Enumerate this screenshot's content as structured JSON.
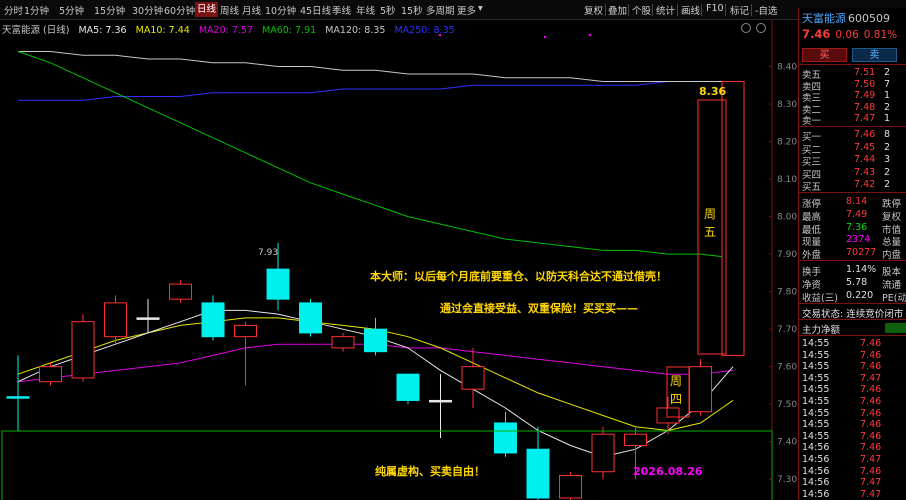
{
  "toolbar": {
    "periods": [
      "分时",
      "1分钟",
      "5分钟",
      "15分钟",
      "30分钟",
      "60分钟",
      "日线",
      "周线",
      "月线",
      "10分钟",
      "45日线",
      "季线",
      "年线",
      "5秒",
      "15秒",
      "多周期",
      "更多"
    ],
    "active_period": "日线",
    "tools": [
      "复权",
      "叠加",
      "个股",
      "统计",
      "画线",
      "F10",
      "标记",
      "-自选"
    ]
  },
  "chart": {
    "stock_label": "天富能源 (日线)",
    "ma5": "MA5: 7.36",
    "ma10": "MA10: 7.44",
    "ma20": "MA20: 7.57",
    "ma60": "MA60: 7.91",
    "ma120": "MA120: 8.35",
    "ma250": "MA250: 8.35",
    "y_ticks": [
      "8.40",
      "8.30",
      "8.20",
      "8.10",
      "8.00",
      "7.90",
      "7.80",
      "7.70",
      "7.60",
      "7.50",
      "7.40",
      "7.30"
    ],
    "high_marker": "7.93",
    "peak_label": "8.36",
    "annotation_1": "本大师：以后每个月底前要重仓、以防天科合达不通过借壳！",
    "annotation_2": "通过会直接受益、双重保险！买买买——",
    "annotation_3": "纯属虚构、买卖自由！",
    "annotation_date": "2026.08.26",
    "box_label_1": "周五",
    "box_label_2": "周四",
    "colors": {
      "up": "#ff3030",
      "down": "#00f0f0",
      "ma5": "#e8e8e8",
      "ma10": "#e8e800",
      "ma20": "#e000e0",
      "ma60": "#00c000",
      "ma120": "#c8c8c8",
      "ma250": "#3030ff",
      "annotation": "#ffd700"
    }
  },
  "chart_data": {
    "type": "candlestick",
    "ylim": [
      7.25,
      8.46
    ],
    "candles": [
      {
        "o": 7.52,
        "c": 7.52,
        "h": 7.63,
        "l": 7.43,
        "dir": "down"
      },
      {
        "o": 7.56,
        "c": 7.6,
        "h": 7.61,
        "l": 7.55,
        "dir": "up"
      },
      {
        "o": 7.57,
        "c": 7.72,
        "h": 7.74,
        "l": 7.56,
        "dir": "up"
      },
      {
        "o": 7.68,
        "c": 7.77,
        "h": 7.79,
        "l": 7.66,
        "dir": "up"
      },
      {
        "o": 7.73,
        "c": 7.73,
        "h": 7.78,
        "l": 7.69,
        "dir": "flat"
      },
      {
        "o": 7.78,
        "c": 7.82,
        "h": 7.83,
        "l": 7.77,
        "dir": "up"
      },
      {
        "o": 7.77,
        "c": 7.68,
        "h": 7.79,
        "l": 7.67,
        "dir": "down"
      },
      {
        "o": 7.68,
        "c": 7.71,
        "h": 7.72,
        "l": 7.55,
        "dir": "up"
      },
      {
        "o": 7.86,
        "c": 7.78,
        "h": 7.93,
        "l": 7.75,
        "dir": "down"
      },
      {
        "o": 7.77,
        "c": 7.69,
        "h": 7.78,
        "l": 7.68,
        "dir": "down"
      },
      {
        "o": 7.65,
        "c": 7.68,
        "h": 7.69,
        "l": 7.64,
        "dir": "up"
      },
      {
        "o": 7.7,
        "c": 7.64,
        "h": 7.73,
        "l": 7.63,
        "dir": "down"
      },
      {
        "o": 7.58,
        "c": 7.51,
        "h": 7.58,
        "l": 7.5,
        "dir": "down"
      },
      {
        "o": 7.51,
        "c": 7.51,
        "h": 7.58,
        "l": 7.41,
        "dir": "flat"
      },
      {
        "o": 7.54,
        "c": 7.6,
        "h": 7.65,
        "l": 7.49,
        "dir": "up"
      },
      {
        "o": 7.45,
        "c": 7.37,
        "h": 7.48,
        "l": 7.36,
        "dir": "down"
      },
      {
        "o": 7.38,
        "c": 7.25,
        "h": 7.44,
        "l": 7.23,
        "dir": "down"
      },
      {
        "o": 7.25,
        "c": 7.31,
        "h": 7.32,
        "l": 7.2,
        "dir": "up"
      },
      {
        "o": 7.32,
        "c": 7.42,
        "h": 7.44,
        "l": 7.3,
        "dir": "up"
      },
      {
        "o": 7.39,
        "c": 7.42,
        "h": 7.44,
        "l": 7.3,
        "dir": "up"
      },
      {
        "o": 7.45,
        "c": 7.49,
        "h": 7.52,
        "l": 7.42,
        "dir": "up"
      },
      {
        "o": 7.48,
        "c": 7.6,
        "h": 7.62,
        "l": 7.47,
        "dir": "up"
      },
      {
        "o": 7.63,
        "c": 8.36,
        "h": 8.36,
        "l": 7.63,
        "dir": "up"
      }
    ],
    "ma5": [
      7.56,
      7.6,
      7.63,
      7.66,
      7.69,
      7.72,
      7.75,
      7.75,
      7.74,
      7.72,
      7.7,
      7.68,
      7.65,
      7.59,
      7.54,
      7.49,
      7.43,
      7.39,
      7.36,
      7.38,
      7.43,
      7.5,
      7.6
    ],
    "ma10": [
      7.58,
      7.61,
      7.64,
      7.67,
      7.69,
      7.71,
      7.72,
      7.73,
      7.73,
      7.72,
      7.71,
      7.7,
      7.68,
      7.65,
      7.61,
      7.57,
      7.53,
      7.5,
      7.47,
      7.44,
      7.43,
      7.45,
      7.51
    ],
    "ma20": [
      7.56,
      7.57,
      7.58,
      7.59,
      7.6,
      7.61,
      7.63,
      7.65,
      7.66,
      7.66,
      7.66,
      7.66,
      7.65,
      7.65,
      7.64,
      7.63,
      7.62,
      7.61,
      7.6,
      7.59,
      7.58,
      7.58,
      7.59
    ],
    "ma60": [
      8.44,
      8.41,
      8.37,
      8.33,
      8.29,
      8.25,
      8.21,
      8.17,
      8.13,
      8.09,
      8.06,
      8.03,
      8.0,
      7.98,
      7.96,
      7.94,
      7.93,
      7.92,
      7.91,
      7.91,
      7.9,
      7.9,
      7.89
    ],
    "ma120": [
      8.44,
      8.44,
      8.43,
      8.43,
      8.42,
      8.42,
      8.41,
      8.41,
      8.4,
      8.4,
      8.39,
      8.39,
      8.38,
      8.38,
      8.38,
      8.37,
      8.37,
      8.37,
      8.36,
      8.36,
      8.36,
      8.36,
      8.36
    ],
    "ma250": [
      8.31,
      8.31,
      8.31,
      8.32,
      8.32,
      8.32,
      8.33,
      8.33,
      8.33,
      8.33,
      8.34,
      8.34,
      8.34,
      8.34,
      8.35,
      8.35,
      8.35,
      8.35,
      8.35,
      8.35,
      8.36,
      8.36,
      8.36
    ]
  },
  "panel": {
    "name": "天富能源",
    "code": "600509",
    "price": "7.46",
    "change": "0.06",
    "pct": "0.81%",
    "buy_btn": "买",
    "sell_btn": "卖",
    "asks": [
      {
        "label": "卖五",
        "price": "7.51",
        "vol": "2"
      },
      {
        "label": "卖四",
        "price": "7.50",
        "vol": "7"
      },
      {
        "label": "卖三",
        "price": "7.49",
        "vol": "1"
      },
      {
        "label": "卖二",
        "price": "7.48",
        "vol": "2"
      },
      {
        "label": "卖一",
        "price": "7.47",
        "vol": "1"
      }
    ],
    "bids": [
      {
        "label": "买一",
        "price": "7.46",
        "vol": "8"
      },
      {
        "label": "买二",
        "price": "7.45",
        "vol": "2"
      },
      {
        "label": "买三",
        "price": "7.44",
        "vol": "3"
      },
      {
        "label": "买四",
        "price": "7.43",
        "vol": "2"
      },
      {
        "label": "买五",
        "price": "7.42",
        "vol": "2"
      }
    ],
    "stats": [
      {
        "k": "涨停",
        "v": "8.14",
        "k2": "跌停"
      },
      {
        "k": "最高",
        "v": "7.49",
        "k2": "复权"
      },
      {
        "k": "最低",
        "v": "7.36",
        "k2": "市值"
      },
      {
        "k": "现量",
        "v": "2374",
        "k2": "总量"
      },
      {
        "k": "外盘",
        "v": "70277",
        "k2": "内盘"
      }
    ],
    "stats2": [
      {
        "k": "换手",
        "v": "1.14%",
        "k2": "股本"
      },
      {
        "k": "净资",
        "v": "5.78",
        "k2": "流通"
      },
      {
        "k": "收益(三)",
        "v": "0.220",
        "k2": "PE(动)"
      }
    ],
    "trade_status": "交易状态: 连续竞价闭市",
    "net_inflow": "主力净额",
    "ticks": [
      {
        "t": "14:55",
        "p": "7.46"
      },
      {
        "t": "14:55",
        "p": "7.46"
      },
      {
        "t": "14:55",
        "p": "7.46"
      },
      {
        "t": "14:55",
        "p": "7.47"
      },
      {
        "t": "14:55",
        "p": "7.46"
      },
      {
        "t": "14:55",
        "p": "7.46"
      },
      {
        "t": "14:55",
        "p": "7.46"
      },
      {
        "t": "14:55",
        "p": "7.46"
      },
      {
        "t": "14:55",
        "p": "7.46"
      },
      {
        "t": "14:56",
        "p": "7.46"
      },
      {
        "t": "14:56",
        "p": "7.47"
      },
      {
        "t": "14:56",
        "p": "7.46"
      },
      {
        "t": "14:56",
        "p": "7.47"
      },
      {
        "t": "14:56",
        "p": "7.47"
      }
    ]
  }
}
